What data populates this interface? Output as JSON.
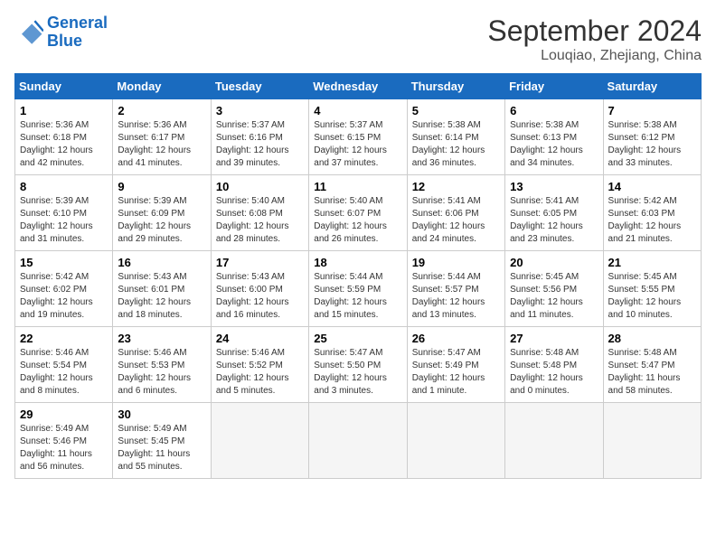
{
  "header": {
    "logo_general": "General",
    "logo_blue": "Blue",
    "month_year": "September 2024",
    "location": "Louqiao, Zhejiang, China"
  },
  "days_of_week": [
    "Sunday",
    "Monday",
    "Tuesday",
    "Wednesday",
    "Thursday",
    "Friday",
    "Saturday"
  ],
  "weeks": [
    [
      {
        "day": 1,
        "sunrise": "5:36 AM",
        "sunset": "6:18 PM",
        "daylight": "12 hours and 42 minutes."
      },
      {
        "day": 2,
        "sunrise": "5:36 AM",
        "sunset": "6:17 PM",
        "daylight": "12 hours and 41 minutes."
      },
      {
        "day": 3,
        "sunrise": "5:37 AM",
        "sunset": "6:16 PM",
        "daylight": "12 hours and 39 minutes."
      },
      {
        "day": 4,
        "sunrise": "5:37 AM",
        "sunset": "6:15 PM",
        "daylight": "12 hours and 37 minutes."
      },
      {
        "day": 5,
        "sunrise": "5:38 AM",
        "sunset": "6:14 PM",
        "daylight": "12 hours and 36 minutes."
      },
      {
        "day": 6,
        "sunrise": "5:38 AM",
        "sunset": "6:13 PM",
        "daylight": "12 hours and 34 minutes."
      },
      {
        "day": 7,
        "sunrise": "5:38 AM",
        "sunset": "6:12 PM",
        "daylight": "12 hours and 33 minutes."
      }
    ],
    [
      {
        "day": 8,
        "sunrise": "5:39 AM",
        "sunset": "6:10 PM",
        "daylight": "12 hours and 31 minutes."
      },
      {
        "day": 9,
        "sunrise": "5:39 AM",
        "sunset": "6:09 PM",
        "daylight": "12 hours and 29 minutes."
      },
      {
        "day": 10,
        "sunrise": "5:40 AM",
        "sunset": "6:08 PM",
        "daylight": "12 hours and 28 minutes."
      },
      {
        "day": 11,
        "sunrise": "5:40 AM",
        "sunset": "6:07 PM",
        "daylight": "12 hours and 26 minutes."
      },
      {
        "day": 12,
        "sunrise": "5:41 AM",
        "sunset": "6:06 PM",
        "daylight": "12 hours and 24 minutes."
      },
      {
        "day": 13,
        "sunrise": "5:41 AM",
        "sunset": "6:05 PM",
        "daylight": "12 hours and 23 minutes."
      },
      {
        "day": 14,
        "sunrise": "5:42 AM",
        "sunset": "6:03 PM",
        "daylight": "12 hours and 21 minutes."
      }
    ],
    [
      {
        "day": 15,
        "sunrise": "5:42 AM",
        "sunset": "6:02 PM",
        "daylight": "12 hours and 19 minutes."
      },
      {
        "day": 16,
        "sunrise": "5:43 AM",
        "sunset": "6:01 PM",
        "daylight": "12 hours and 18 minutes."
      },
      {
        "day": 17,
        "sunrise": "5:43 AM",
        "sunset": "6:00 PM",
        "daylight": "12 hours and 16 minutes."
      },
      {
        "day": 18,
        "sunrise": "5:44 AM",
        "sunset": "5:59 PM",
        "daylight": "12 hours and 15 minutes."
      },
      {
        "day": 19,
        "sunrise": "5:44 AM",
        "sunset": "5:57 PM",
        "daylight": "12 hours and 13 minutes."
      },
      {
        "day": 20,
        "sunrise": "5:45 AM",
        "sunset": "5:56 PM",
        "daylight": "12 hours and 11 minutes."
      },
      {
        "day": 21,
        "sunrise": "5:45 AM",
        "sunset": "5:55 PM",
        "daylight": "12 hours and 10 minutes."
      }
    ],
    [
      {
        "day": 22,
        "sunrise": "5:46 AM",
        "sunset": "5:54 PM",
        "daylight": "12 hours and 8 minutes."
      },
      {
        "day": 23,
        "sunrise": "5:46 AM",
        "sunset": "5:53 PM",
        "daylight": "12 hours and 6 minutes."
      },
      {
        "day": 24,
        "sunrise": "5:46 AM",
        "sunset": "5:52 PM",
        "daylight": "12 hours and 5 minutes."
      },
      {
        "day": 25,
        "sunrise": "5:47 AM",
        "sunset": "5:50 PM",
        "daylight": "12 hours and 3 minutes."
      },
      {
        "day": 26,
        "sunrise": "5:47 AM",
        "sunset": "5:49 PM",
        "daylight": "12 hours and 1 minute."
      },
      {
        "day": 27,
        "sunrise": "5:48 AM",
        "sunset": "5:48 PM",
        "daylight": "12 hours and 0 minutes."
      },
      {
        "day": 28,
        "sunrise": "5:48 AM",
        "sunset": "5:47 PM",
        "daylight": "11 hours and 58 minutes."
      }
    ],
    [
      {
        "day": 29,
        "sunrise": "5:49 AM",
        "sunset": "5:46 PM",
        "daylight": "11 hours and 56 minutes."
      },
      {
        "day": 30,
        "sunrise": "5:49 AM",
        "sunset": "5:45 PM",
        "daylight": "11 hours and 55 minutes."
      },
      null,
      null,
      null,
      null,
      null
    ]
  ]
}
